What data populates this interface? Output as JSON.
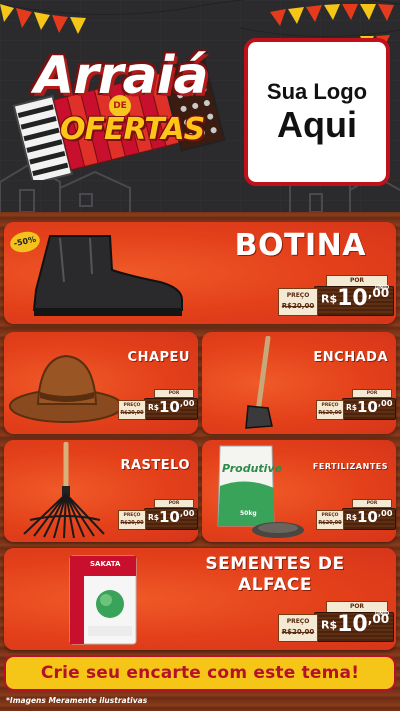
{
  "header": {
    "logo_title": "Arraiá",
    "logo_de": "DE",
    "logo_subtitle": "OFERTAS",
    "brand_box": {
      "line1": "Sua Logo",
      "line2": "Aqui"
    }
  },
  "colors": {
    "card": "#e6441c",
    "banner": "#f5c518",
    "banner_text": "#b5122a",
    "logo_border": "#c0101a"
  },
  "price_template": {
    "por": "POR",
    "preco": "PREÇO",
    "currency": "R$",
    "unid": "UNID"
  },
  "products": [
    {
      "name": "BOTINA",
      "discount": "-50%",
      "old_price": "R$20,00",
      "price_int": "10",
      "price_cents": ",00",
      "icon": "boot-icon"
    },
    {
      "name": "CHAPEU",
      "old_price": "R$20,00",
      "price_int": "10",
      "price_cents": ",00",
      "icon": "hat-icon"
    },
    {
      "name": "ENCHADA",
      "old_price": "R$20,00",
      "price_int": "10",
      "price_cents": ",00",
      "icon": "hoe-icon"
    },
    {
      "name": "RASTELO",
      "old_price": "R$20,00",
      "price_int": "10",
      "price_cents": ",00",
      "icon": "rake-icon"
    },
    {
      "name": "FERTILIZANTES",
      "old_price": "R$20,00",
      "price_int": "10",
      "price_cents": ",00",
      "icon": "fertilizer-bag-icon",
      "package_brand": "Produtive",
      "package_weight": "50kg"
    },
    {
      "name": "SEMENTES DE ALFACE",
      "old_price": "R$20,00",
      "price_int": "10",
      "price_cents": ",00",
      "icon": "seed-packet-icon",
      "package_brand": "SAKATA"
    }
  ],
  "footer": {
    "banner": "Crie seu encarte com este tema!",
    "disclaimer": "*Imagens Meramente ilustrativas"
  }
}
